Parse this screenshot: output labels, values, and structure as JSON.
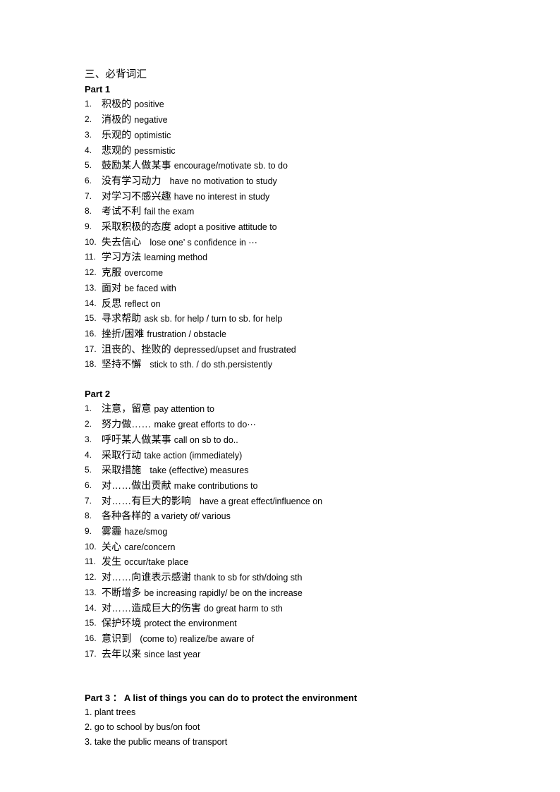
{
  "document": {
    "title": "三、必背词汇",
    "sections": [
      {
        "heading": "Part 1",
        "style": "numbered",
        "items": [
          {
            "num": "1.",
            "cn": "积极的",
            "gap": "small",
            "en": "positive"
          },
          {
            "num": "2.",
            "cn": "消极的",
            "gap": "small",
            "en": "negative"
          },
          {
            "num": "3.",
            "cn": "乐观的",
            "gap": "small",
            "en": "optimistic"
          },
          {
            "num": "4.",
            "cn": "悲观的",
            "gap": "small",
            "en": "pessmistic"
          },
          {
            "num": "5.",
            "cn": "鼓励某人做某事",
            "gap": "small",
            "en": "encourage/motivate sb. to do"
          },
          {
            "num": "6.",
            "cn": "没有学习动力",
            "gap": "wide",
            "en": "have no motivation to study"
          },
          {
            "num": "7.",
            "cn": "对学习不感兴趣",
            "gap": "small",
            "en": "have no interest in study"
          },
          {
            "num": "8.",
            "cn": "考试不利",
            "gap": "small",
            "en": "fail the exam"
          },
          {
            "num": "9.",
            "cn": "采取积极的态度",
            "gap": "small",
            "en": "adopt a positive attitude to"
          },
          {
            "num": "10.",
            "cn": "失去信心",
            "gap": "wide",
            "en": "lose one’ s confidence in ⋯"
          },
          {
            "num": "11.",
            "cn": "学习方法",
            "gap": "small",
            "en": "learning method"
          },
          {
            "num": "12.",
            "cn": "克服",
            "gap": "small",
            "en": "overcome"
          },
          {
            "num": "13.",
            "cn": "面对",
            "gap": "small",
            "en": "be faced with"
          },
          {
            "num": "14.",
            "cn": "反思",
            "gap": "small",
            "en": "reflect on"
          },
          {
            "num": "15.",
            "cn": "寻求帮助",
            "gap": "small",
            "en": "ask sb. for help / turn to sb. for help"
          },
          {
            "num": "16.",
            "cn": "挫折/困难",
            "gap": "small",
            "en": "frustration / obstacle"
          },
          {
            "num": "17.",
            "cn": "沮丧的、挫败的",
            "gap": "small",
            "en": "depressed/upset and frustrated"
          },
          {
            "num": "18.",
            "cn": "坚持不懈",
            "gap": "wide",
            "en": "stick to sth. / do sth.persistently"
          }
        ]
      },
      {
        "heading": "Part 2",
        "style": "numbered",
        "items": [
          {
            "num": "1.",
            "cn": "注意，留意",
            "gap": "small",
            "en": "pay attention to"
          },
          {
            "num": "2.",
            "cn": "努力做……",
            "gap": "small",
            "en": "make great efforts to do⋯"
          },
          {
            "num": "3.",
            "cn": "呼吁某人做某事",
            "gap": "small",
            "en": "call on sb to do.."
          },
          {
            "num": "4.",
            "cn": "采取行动",
            "gap": "small",
            "en": "take action (immediately)"
          },
          {
            "num": "5.",
            "cn": "采取措施",
            "gap": "wide",
            "en": "take (effective) measures"
          },
          {
            "num": "6.",
            "cn": "对……做出贡献",
            "gap": "small",
            "en": "make contributions to"
          },
          {
            "num": "7.",
            "cn": "对……有巨大的影响",
            "gap": "wide",
            "en": "have a great effect/influence on"
          },
          {
            "num": "8.",
            "cn": "各种各样的",
            "gap": "small",
            "en": "a variety of/ various"
          },
          {
            "num": "9.",
            "cn": "雾霾",
            "gap": "small",
            "en": "haze/smog"
          },
          {
            "num": "10.",
            "cn": "关心",
            "gap": "small",
            "en": "care/concern"
          },
          {
            "num": "11.",
            "cn": "发生",
            "gap": "small",
            "en": "occur/take place"
          },
          {
            "num": "12.",
            "cn": "对……向谁表示感谢",
            "gap": "small",
            "en": "thank to sb for sth/doing sth"
          },
          {
            "num": "13.",
            "cn": "不断增多",
            "gap": "small",
            "en": "be increasing rapidly/ be on the increase"
          },
          {
            "num": "14.",
            "cn": "对……造成巨大的伤害",
            "gap": "small",
            "en": "do great harm to sth"
          },
          {
            "num": "15.",
            "cn": "保护环境",
            "gap": "small",
            "en": "protect the environment"
          },
          {
            "num": "16.",
            "cn": "意识到",
            "gap": "wide",
            "en": "(come to) realize/be aware of"
          },
          {
            "num": "17.",
            "cn": "去年以来",
            "gap": "small",
            "en": "since last year"
          }
        ]
      },
      {
        "heading": "Part 3  ：  A list of things you can do to protect the environment",
        "style": "plain",
        "items": [
          {
            "text": "1. plant trees"
          },
          {
            "text": "2. go to school by bus/on foot"
          },
          {
            "text": "3. take the public means of transport"
          }
        ]
      }
    ]
  }
}
